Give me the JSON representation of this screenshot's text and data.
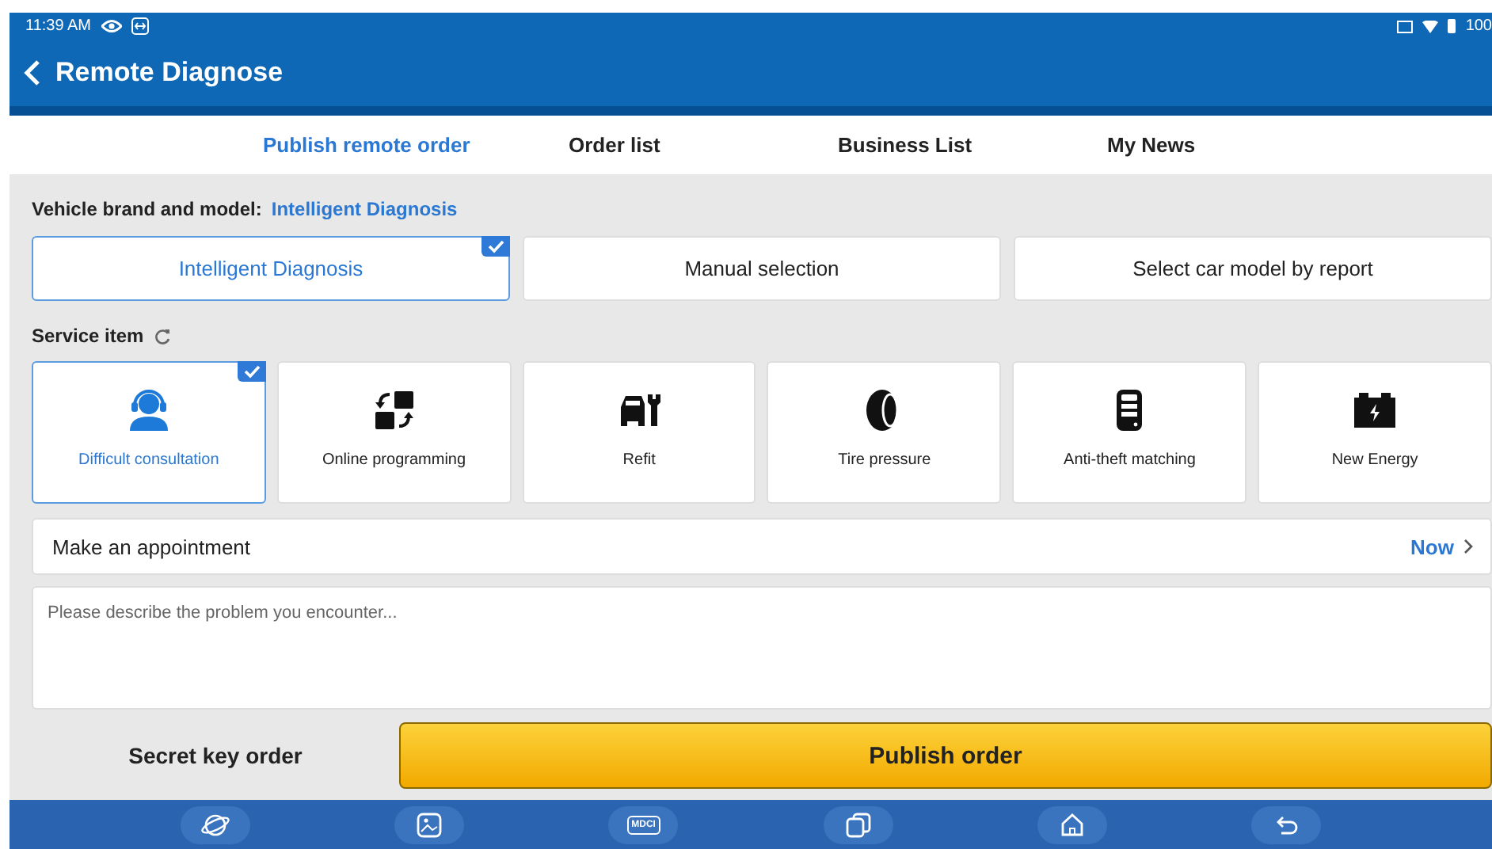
{
  "status_bar": {
    "time": "11:39 AM",
    "battery": "100"
  },
  "header": {
    "title": "Remote Diagnose"
  },
  "tabs": [
    {
      "label": "Publish remote order",
      "selected": true
    },
    {
      "label": "Order list",
      "selected": false
    },
    {
      "label": "Business List",
      "selected": false
    },
    {
      "label": "My News",
      "selected": false
    }
  ],
  "vehicle": {
    "label": "Vehicle brand and model:",
    "value": "Intelligent Diagnosis"
  },
  "modes": [
    {
      "label": "Intelligent Diagnosis",
      "selected": true
    },
    {
      "label": "Manual selection",
      "selected": false
    },
    {
      "label": "Select car model by report",
      "selected": false
    }
  ],
  "service": {
    "label": "Service item"
  },
  "services": [
    {
      "kind": "headset",
      "label": "Difficult consultation",
      "selected": true
    },
    {
      "kind": "swap",
      "label": "Online programming",
      "selected": false
    },
    {
      "kind": "refit",
      "label": "Refit",
      "selected": false
    },
    {
      "kind": "tire",
      "label": "Tire pressure",
      "selected": false
    },
    {
      "kind": "remote",
      "label": "Anti-theft matching",
      "selected": false
    },
    {
      "kind": "battery",
      "label": "New Energy",
      "selected": false
    }
  ],
  "appointment": {
    "label": "Make an appointment",
    "value": "Now"
  },
  "description": {
    "placeholder": "Please describe the problem you encounter..."
  },
  "footer": {
    "secret": "Secret key order",
    "publish": "Publish order"
  },
  "nav": [
    {
      "kind": "planet"
    },
    {
      "kind": "gallery"
    },
    {
      "kind": "mdci",
      "label": "MDCI"
    },
    {
      "kind": "copy"
    },
    {
      "kind": "home"
    },
    {
      "kind": "back"
    }
  ]
}
